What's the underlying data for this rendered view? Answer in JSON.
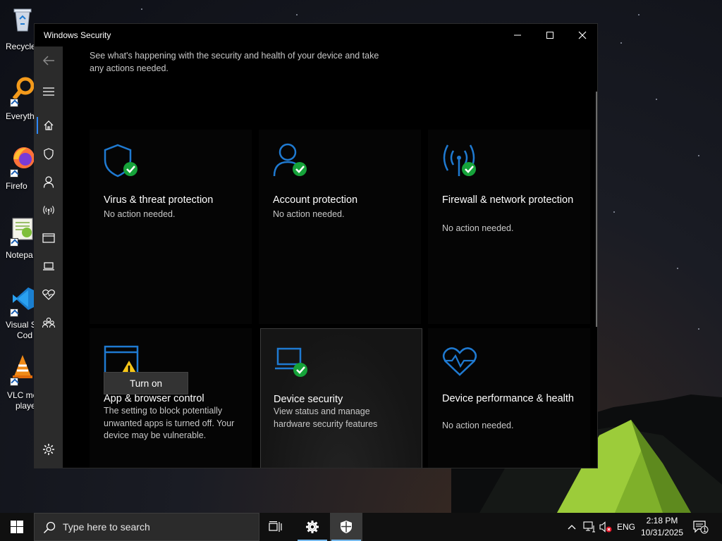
{
  "desktop": {
    "icons": [
      {
        "label": "Recycle",
        "icon": "recycle-bin-icon"
      },
      {
        "label": "Everyth",
        "icon": "everything-search-icon"
      },
      {
        "label": "Firefo",
        "icon": "firefox-icon"
      },
      {
        "label": "Notepa",
        "icon": "notepad-plus-plus-icon"
      },
      {
        "label": "Visual St",
        "label2": "Cod",
        "icon": "vscode-icon"
      },
      {
        "label": "VLC me",
        "label2": "playe",
        "icon": "vlc-icon"
      }
    ]
  },
  "window": {
    "title": "Windows Security",
    "controls": {
      "minimize": "minimize-icon",
      "maximize": "maximize-icon",
      "close": "close-icon"
    }
  },
  "sidebar": {
    "items": [
      {
        "name": "back",
        "icon": "back-arrow-icon"
      },
      {
        "name": "menu",
        "icon": "hamburger-icon"
      },
      {
        "name": "home",
        "icon": "home-icon",
        "active": true
      },
      {
        "name": "virus",
        "icon": "shield-icon"
      },
      {
        "name": "account",
        "icon": "person-icon"
      },
      {
        "name": "firewall",
        "icon": "antenna-icon"
      },
      {
        "name": "app-browser",
        "icon": "browser-window-icon"
      },
      {
        "name": "device-security",
        "icon": "laptop-icon"
      },
      {
        "name": "device-performance",
        "icon": "heart-icon"
      },
      {
        "name": "family",
        "icon": "family-icon"
      },
      {
        "name": "settings",
        "icon": "gear-icon"
      }
    ]
  },
  "main": {
    "intro": "See what's happening with the security and health of your device and take any actions needed.",
    "tiles": [
      {
        "title": "Virus & threat protection",
        "desc": "No action needed.",
        "status": "ok"
      },
      {
        "title": "Account protection",
        "desc": "No action needed.",
        "status": "ok"
      },
      {
        "title": "Firewall & network protection",
        "desc": "No action needed.",
        "status": "ok"
      },
      {
        "title": "App & browser control",
        "desc": "The setting to block potentially unwanted apps is turned off. Your device may be vulnerable.",
        "status": "warning",
        "button": "Turn on"
      },
      {
        "title": "Device security",
        "desc": "View status and manage hardware security features",
        "status": "ok"
      },
      {
        "title": "Device performance & health",
        "desc": "No action needed.",
        "status": "none"
      }
    ]
  },
  "colors": {
    "accent": "#1f7ad1",
    "ok": "#16a33a",
    "warning": "#f5c518",
    "sidebar": "#2b2b2b",
    "taskbar": "#101010"
  },
  "taskbar": {
    "search_placeholder": "Type here to search",
    "apps": [
      "task-view-icon",
      "settings-gear-icon",
      "windows-security-shield-icon"
    ],
    "tray": {
      "language": "ENG",
      "time": "2:18 PM",
      "date": "10/31/2025",
      "notifications": "1"
    }
  }
}
